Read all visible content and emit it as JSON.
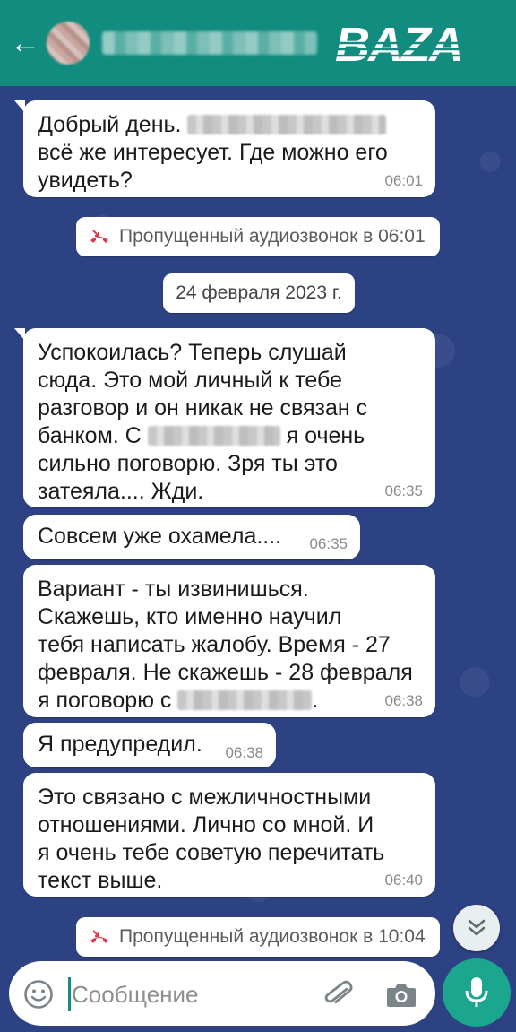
{
  "header": {
    "back_glyph": "←",
    "contact_name": "",
    "logo_text": "BAZA"
  },
  "messages": [
    {
      "text_a": "Добрый день. ",
      "text_b": "\nвсё же интересует. Где можно его\nувидеть?",
      "time": "06:01"
    },
    {
      "text_a": "Успокоилась? Теперь слушай\nсюда. Это мой личный к тебе\nразговор и он никак не связан с\nбанком. С ",
      "text_b": " я очень\nсильно поговорю. Зря ты это\nзатеяла.... Жди.",
      "time": "06:35"
    },
    {
      "text": "Совсем уже охамела....",
      "time": "06:35"
    },
    {
      "text_a": "Вариант - ты извинишься.\nСкажешь, кто именно научил\nтебя написать жалобу. Время - 27\nфевраля. Не скажешь - 28 февраля\nя поговорю с ",
      "text_b": ".",
      "time": "06:38"
    },
    {
      "text": "Я предупредил.",
      "time": "06:38"
    },
    {
      "text": "Это связано с межличностными\nотношениями. Лично со мной. И\nя очень тебе советую перечитать\nтекст выше.",
      "time": "06:40"
    }
  ],
  "system_events": {
    "missed_call_1": "Пропущенный аудиозвонок в 06:01",
    "date_separator": "24 февраля 2023 г.",
    "missed_call_2": "Пропущенный аудиозвонок в 10:04"
  },
  "input": {
    "placeholder": "Сообщение"
  },
  "colors": {
    "header": "#128c7e",
    "mic_button": "#1aa68f",
    "missed_call_icon": "#e0384b",
    "wallpaper": "#2c4282"
  },
  "icons": [
    "back-arrow-icon",
    "missed-call-icon",
    "chevron-double-down-icon",
    "emoji-icon",
    "paperclip-icon",
    "camera-icon",
    "microphone-icon"
  ]
}
